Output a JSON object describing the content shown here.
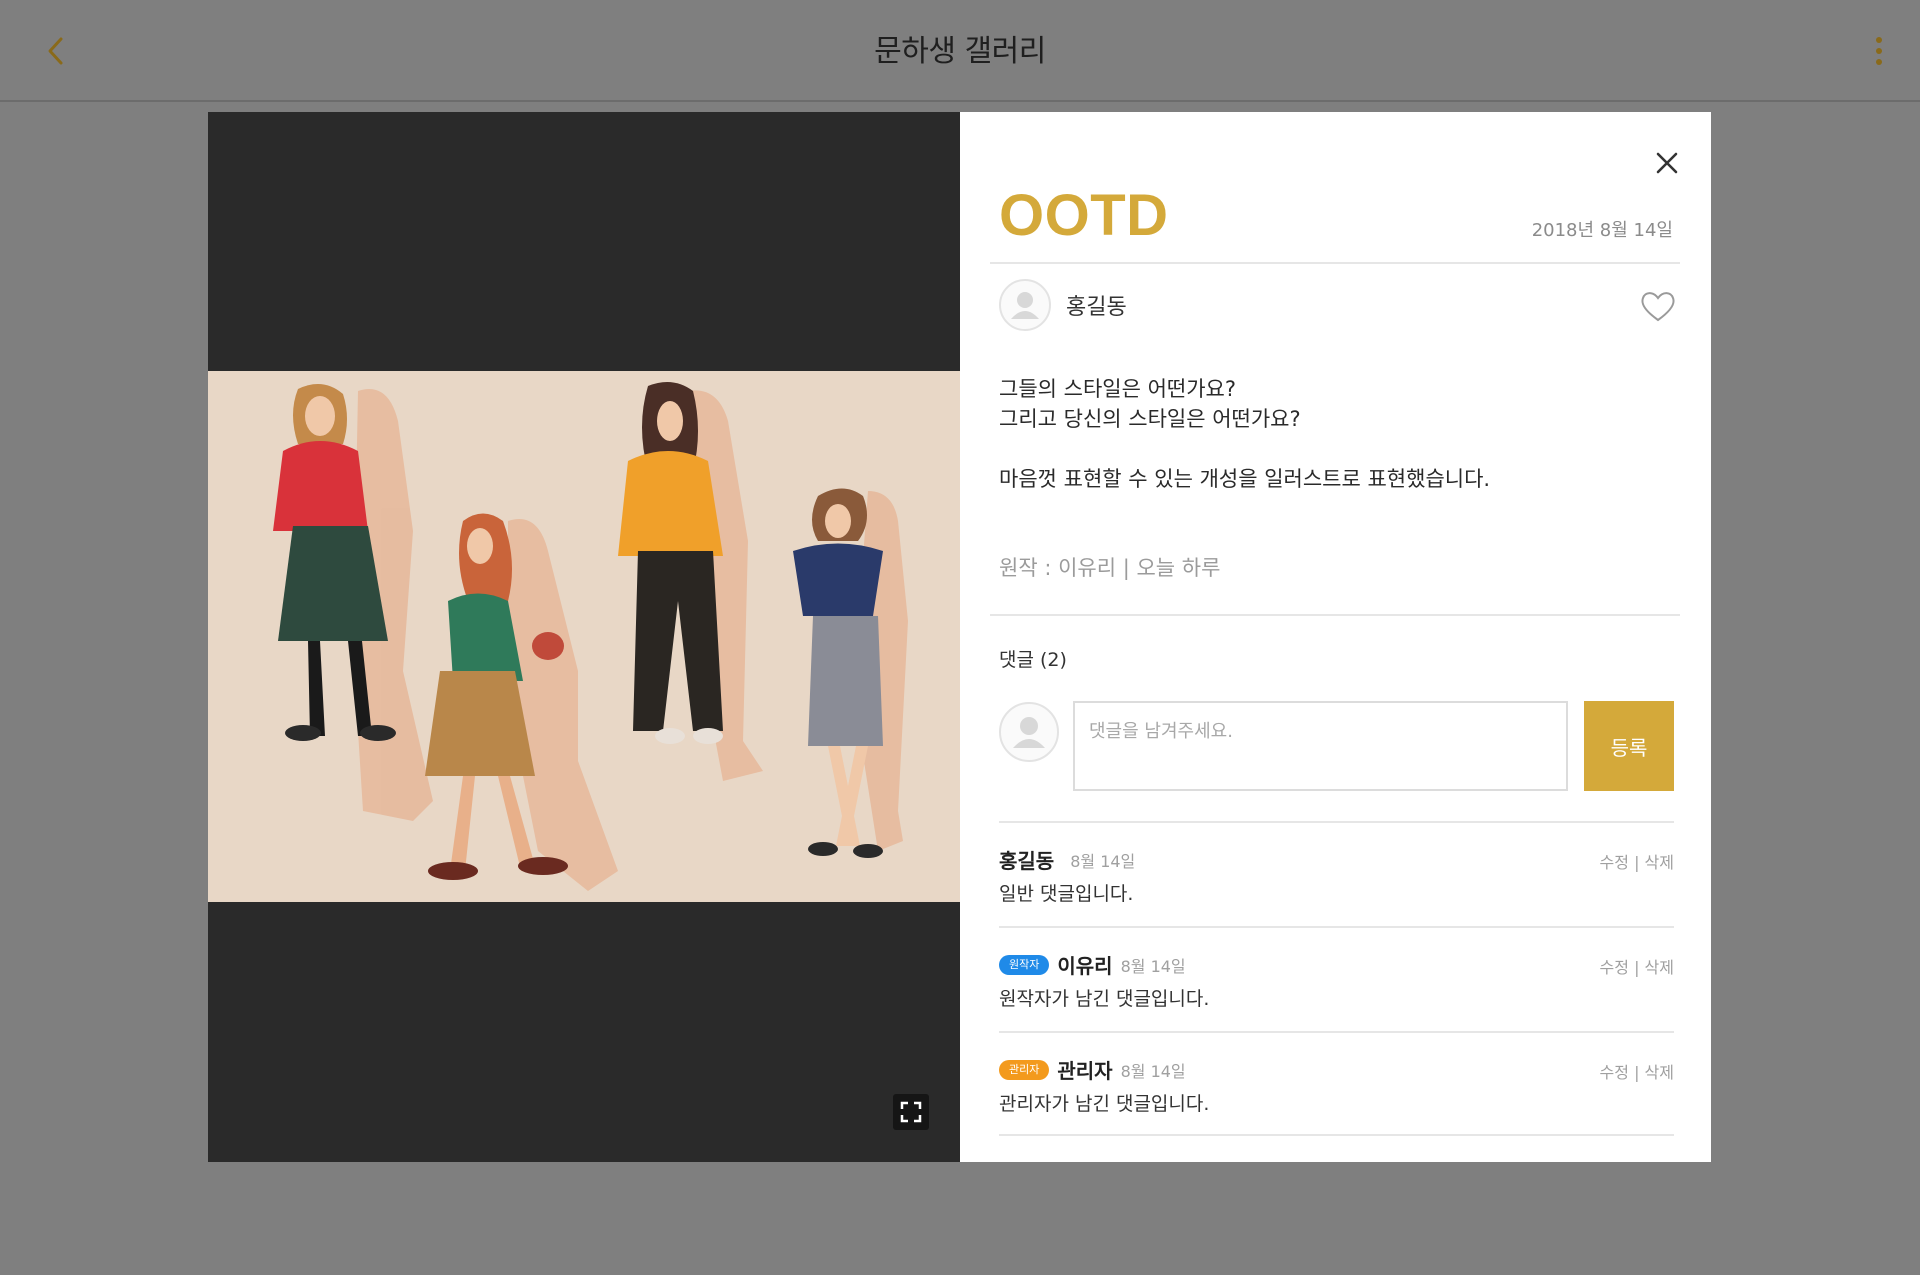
{
  "appbar": {
    "title": "문하생 갤러리",
    "back_icon": "chevron-left-icon",
    "more_icon": "more-vertical-icon",
    "accent_color": "#8a6a1a"
  },
  "post": {
    "title": "OOTD",
    "date": "2018년 8월 14일",
    "author": "홍길동",
    "body_lines": [
      "그들의 스타일은 어떤가요?",
      "그리고 당신의 스타일은 어떤가요?",
      "",
      "마음껏 표현할 수 있는 개성을 일러스트로 표현했습니다."
    ],
    "credit": "원작 : 이유리 | 오늘 하루",
    "title_color": "#d4a93a"
  },
  "comments": {
    "heading": "댓글 (2)",
    "input_placeholder": "댓글을 남겨주세요.",
    "submit_label": "등록",
    "items": [
      {
        "badge": "",
        "name": "홍길동",
        "date": "8월 14일",
        "text": "일반 댓글입니다.",
        "edit": "수정",
        "sep": " | ",
        "delete": "삭제"
      },
      {
        "badge": "원작자",
        "name": "이유리",
        "date": "8월 14일",
        "text": "원작자가 남긴 댓글입니다.",
        "edit": "수정",
        "sep": " | ",
        "delete": "삭제"
      },
      {
        "badge": "관리자",
        "name": "관리자",
        "date": "8월 14일",
        "text": "관리자가 남긴 댓글입니다.",
        "edit": "수정",
        "sep": " | ",
        "delete": "삭제"
      }
    ]
  }
}
